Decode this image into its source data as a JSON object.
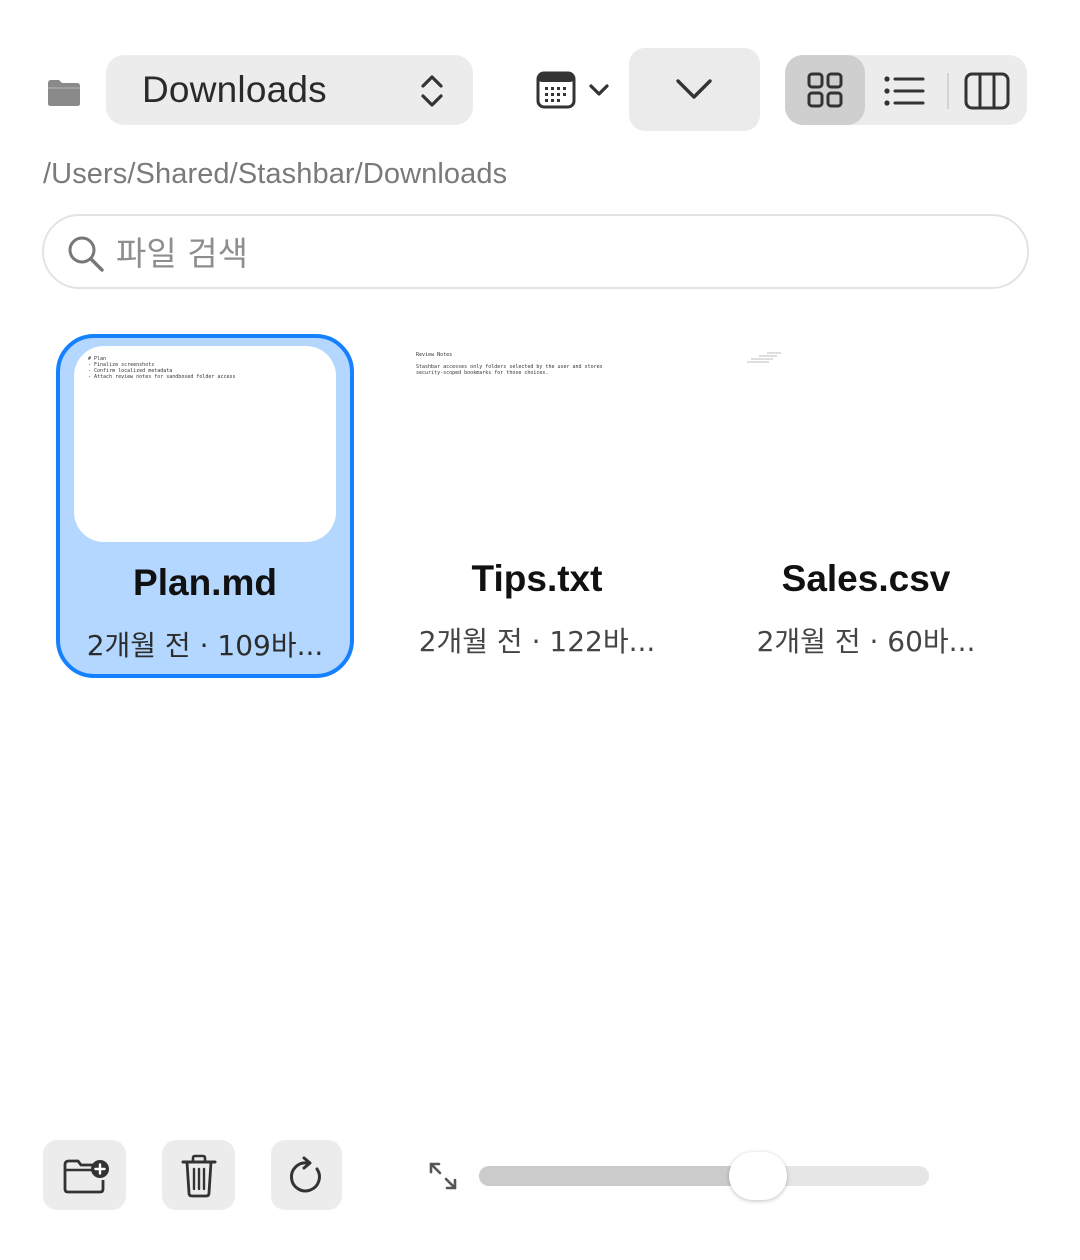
{
  "toolbar": {
    "folder_name": "Downloads",
    "icons": {
      "folder": "folder-icon",
      "updown": "chevron-up-down-icon",
      "calendar": "calendar-icon",
      "sort": "chevron-down-icon",
      "grid_view": "grid-view-icon",
      "list_view": "list-view-icon",
      "column_view": "column-view-icon"
    },
    "active_view": "grid"
  },
  "path": "/Users/Shared/Stashbar/Downloads",
  "search": {
    "placeholder": "파일 검색",
    "value": ""
  },
  "files": [
    {
      "name": "Plan.md",
      "meta": "2개월 전 · 109바...",
      "selected": true,
      "preview": "# Plan\n- Finalize screenshots\n- Confirm localized metadata\n- Attach review notes for sandboxed folder access"
    },
    {
      "name": "Tips.txt",
      "meta": "2개월 전 · 122바...",
      "selected": false,
      "preview": "Review Notes\n\nStashbar accesses only folders selected by the user and stores\nsecurity-scoped bookmarks for those choices."
    },
    {
      "name": "Sales.csv",
      "meta": "2개월 전 · 60바...",
      "selected": false,
      "preview": ""
    }
  ],
  "bottom": {
    "icons": {
      "new_folder": "new-folder-icon",
      "trash": "trash-icon",
      "refresh": "refresh-icon",
      "resize": "resize-icon"
    },
    "zoom_level": 0.62
  },
  "colors": {
    "accent": "#1681ff",
    "selection_fill": "#b3d7ff",
    "control_bg": "#ececec"
  }
}
